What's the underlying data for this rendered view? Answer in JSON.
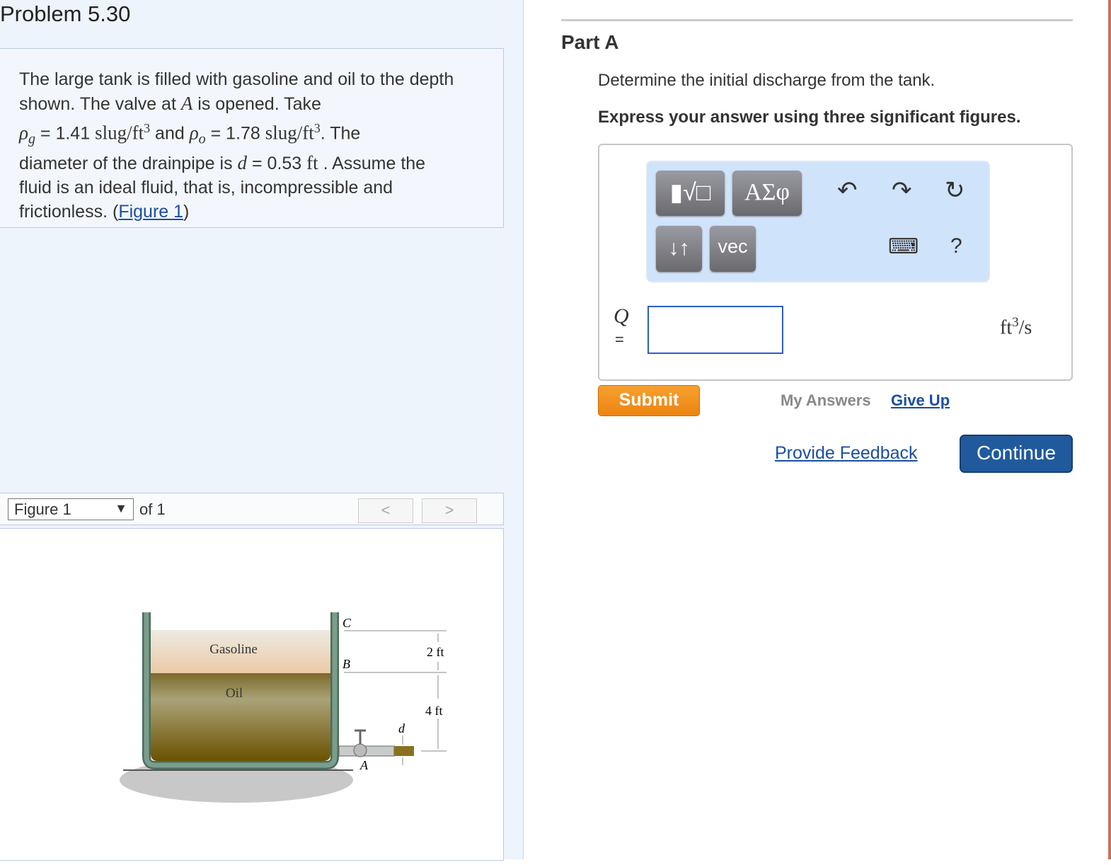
{
  "problem": {
    "title": "Problem 5.30",
    "t1": "The large tank is filled with gasoline and oil to the depth shown. The valve at ",
    "A": "A",
    "t2": " is opened. Take",
    "rho": "ρ",
    "g": "g",
    "t3": " = 1.41 ",
    "slugft": "slug/ft",
    "three": "3",
    "and": " and ",
    "o": "o",
    "t4": " = 1.78 ",
    "t5": ". The",
    "t6": "diameter of the drainpipe is ",
    "d": "d",
    "t7": " = 0.53 ",
    "ft": "ft",
    "t8": " . Assume the",
    "t9": "fluid is an ideal fluid, that is, incompressible and",
    "t10": "frictionless. (",
    "fig_link": "Figure 1",
    "t11": ")"
  },
  "figure_nav": {
    "selected": "Figure 1",
    "of": "of 1",
    "prev": "<",
    "next": ">"
  },
  "figure": {
    "gasoline": "Gasoline",
    "oil": "Oil",
    "C": "C",
    "B": "B",
    "A": "A",
    "d": "d",
    "dim1": "2 ft",
    "dim2": "4 ft"
  },
  "part": {
    "label": "Part A",
    "question": "Determine the initial discharge from the tank.",
    "instruction": "Express your answer using three significant figures.",
    "toolbar": {
      "templates": "▮√□",
      "greek": "ΑΣφ",
      "arrows": "↓↑",
      "vec": "vec",
      "undo": "↶",
      "redo": "↷",
      "reset": "↻",
      "keyboard": "⌨",
      "help": "?"
    },
    "answer_label": "Q",
    "equals": "=",
    "answer_value": "",
    "unit": "ft",
    "unit_exp": "3",
    "unit_tail": "/s"
  },
  "actions": {
    "submit": "Submit",
    "my_answers": "My Answers",
    "give_up": "Give Up",
    "feedback": "Provide Feedback",
    "continue": "Continue"
  }
}
